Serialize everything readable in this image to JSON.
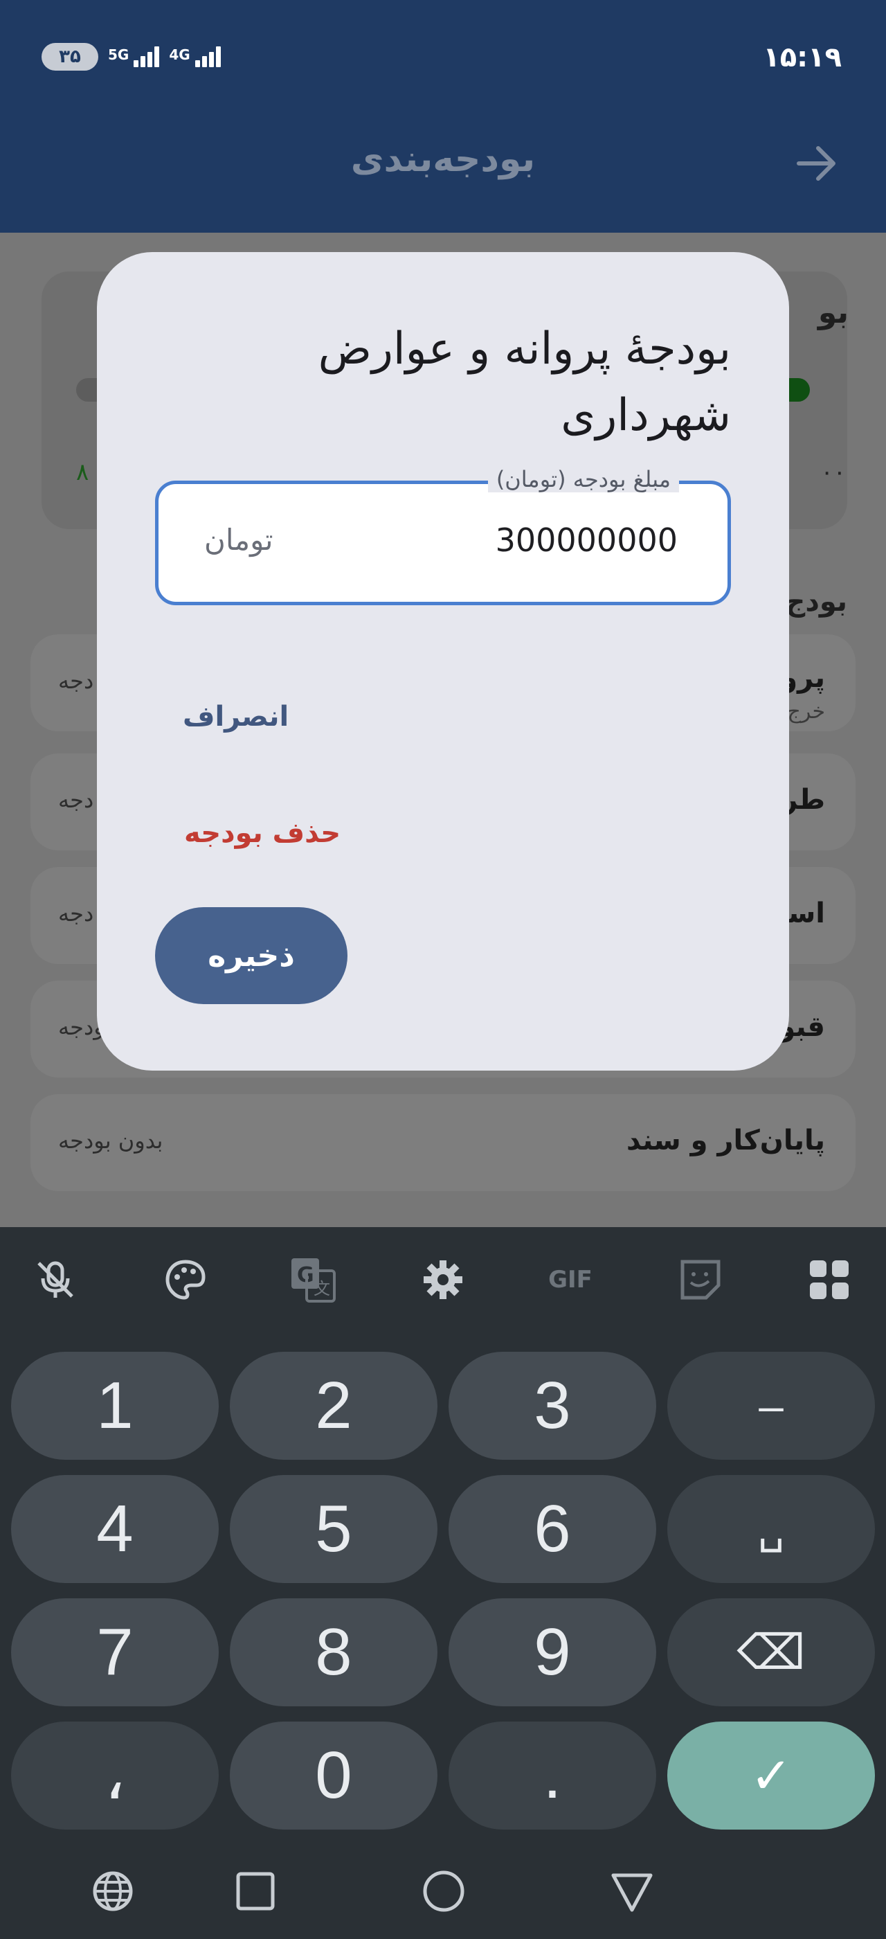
{
  "status": {
    "time": "۱۵:۱۹",
    "battery": "۳۵",
    "net1": "5G",
    "net2": "4G"
  },
  "header": {
    "title": "بودجه‌بندی"
  },
  "background": {
    "summary_title": "بو",
    "summary_amount": "۰۰",
    "summary_left_amount": "۸",
    "section_title": "بودج",
    "rows": [
      {
        "title": "پرو",
        "sub": "خرج",
        "status": "دجه"
      },
      {
        "title": "طرا",
        "status": "دجه"
      },
      {
        "title": "اسنا",
        "status": "دجه"
      },
      {
        "title": "قبوض و انشعابات",
        "status": "بدون بودجه"
      },
      {
        "title": "پایان‌کار و سند",
        "status": "بدون بودجه"
      }
    ]
  },
  "dialog": {
    "title": "بودجهٔ پروانه و عوارض شهرداری",
    "field_label": "مبلغ بودجه (تومان)",
    "field_value": "300000000",
    "field_suffix": "تومان",
    "cancel": "انصراف",
    "delete": "حذف بودجه",
    "save": "ذخیره"
  },
  "keyboard": {
    "toolbar": [
      "mic-off-icon",
      "palette-icon",
      "translate-icon",
      "gear-icon",
      "gif-icon",
      "sticker-icon",
      "apps-grid-icon"
    ],
    "gif_label": "GIF",
    "keys": [
      "1",
      "2",
      "3",
      "–",
      "4",
      "5",
      "6",
      "␣",
      "7",
      "8",
      "9",
      "⌫",
      "،",
      "0",
      ".",
      "✓"
    ]
  },
  "nav": [
    "globe-icon",
    "recents-icon",
    "home-icon",
    "back-icon"
  ]
}
